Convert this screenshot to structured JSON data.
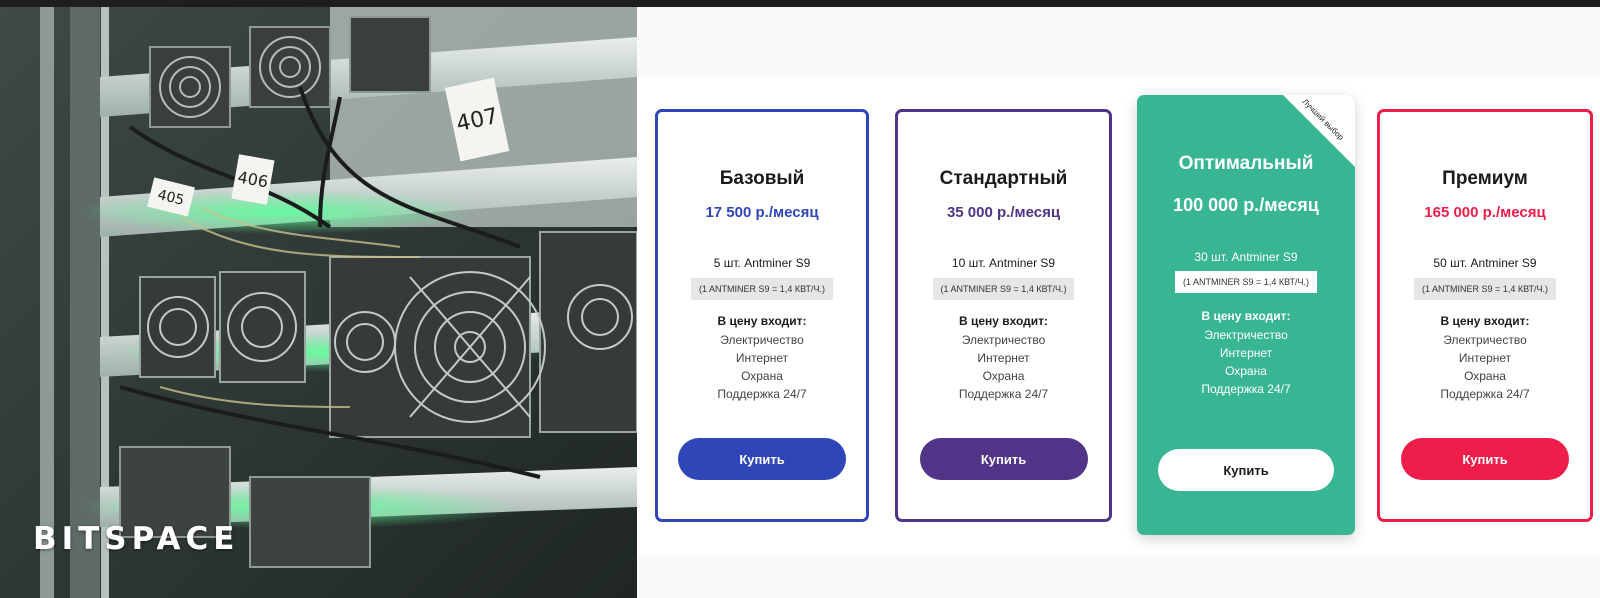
{
  "brand": {
    "logo_text": "BITSPACE"
  },
  "photo": {
    "rack_tags": [
      "407",
      "406",
      "405"
    ]
  },
  "ribbon": {
    "label": "Лучший выбор"
  },
  "plans": [
    {
      "name": "Базовый",
      "price": "17 500 р./месяц",
      "units": "5 шт. Antminer S9",
      "power_note": "(1 ANTMINER S9 = 1,4 КВТ/Ч.)",
      "includes_title": "В цену входит:",
      "includes": [
        "Электричество",
        "Интернет",
        "Охрана",
        "Поддержка 24/7"
      ],
      "button": "Купить",
      "accent": "#2e46b8"
    },
    {
      "name": "Стандартный",
      "price": "35 000 р./месяц",
      "units": "10 шт. Antminer S9",
      "power_note": "(1 ANTMINER S9 = 1,4 КВТ/Ч.)",
      "includes_title": "В цену входит:",
      "includes": [
        "Электричество",
        "Интернет",
        "Охрана",
        "Поддержка 24/7"
      ],
      "button": "Купить",
      "accent": "#4f3487"
    },
    {
      "name": "Оптимальный",
      "price": "100 000 р./месяц",
      "units": "30 шт. Antminer S9",
      "power_note": "(1 ANTMINER S9 = 1,4 КВТ/Ч.)",
      "includes_title": "В цену входит:",
      "includes": [
        "Электричество",
        "Интернет",
        "Охрана",
        "Поддержка 24/7"
      ],
      "button": "Купить",
      "accent": "#38b694"
    },
    {
      "name": "Премиум",
      "price": "165 000 р./месяц",
      "units": "50 шт. Antminer S9",
      "power_note": "(1 ANTMINER S9 = 1,4 КВТ/Ч.)",
      "includes_title": "В цену входит:",
      "includes": [
        "Электричество",
        "Интернет",
        "Охрана",
        "Поддержка 24/7"
      ],
      "button": "Купить",
      "accent": "#ef1d49"
    }
  ]
}
